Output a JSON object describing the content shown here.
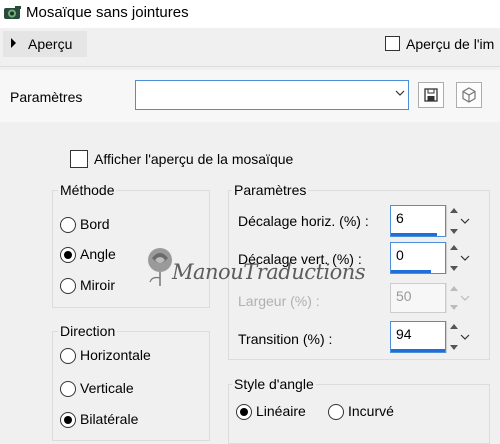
{
  "window": {
    "title": "Mosaïque sans jointures"
  },
  "preview": {
    "toggle_label": "Aperçu",
    "image_preview_label": "Aperçu de l'im"
  },
  "params": {
    "label": "Paramètres",
    "select_value": ""
  },
  "show_mosaic_preview_label": "Afficher l'aperçu de la mosaïque",
  "method": {
    "title": "Méthode",
    "options": [
      "Bord",
      "Angle",
      "Miroir"
    ],
    "selected": "Angle"
  },
  "direction": {
    "title": "Direction",
    "options": [
      "Horizontale",
      "Verticale",
      "Bilatérale"
    ],
    "selected": "Bilatérale"
  },
  "parametres": {
    "title": "Paramètres",
    "fields": [
      {
        "label": "Décalage horiz. (%) :",
        "value": "6",
        "enabled": true,
        "fill": 0.06
      },
      {
        "label": "Décalage vert. (%) :",
        "value": "0",
        "enabled": true,
        "fill": 0.0
      },
      {
        "label": "Largeur (%) :",
        "value": "50",
        "enabled": false,
        "fill": 0.5
      },
      {
        "label": "Transition (%) :",
        "value": "94",
        "enabled": true,
        "fill": 0.94
      }
    ]
  },
  "corner_style": {
    "title": "Style d'angle",
    "options": [
      "Linéaire",
      "Incurvé"
    ],
    "selected": "Linéaire"
  },
  "watermark": {
    "text": "ManouTraductions"
  },
  "colors": {
    "accent": "#1e6fd9",
    "focus_border": "#4a90d9",
    "background": "#f0f0f0"
  }
}
